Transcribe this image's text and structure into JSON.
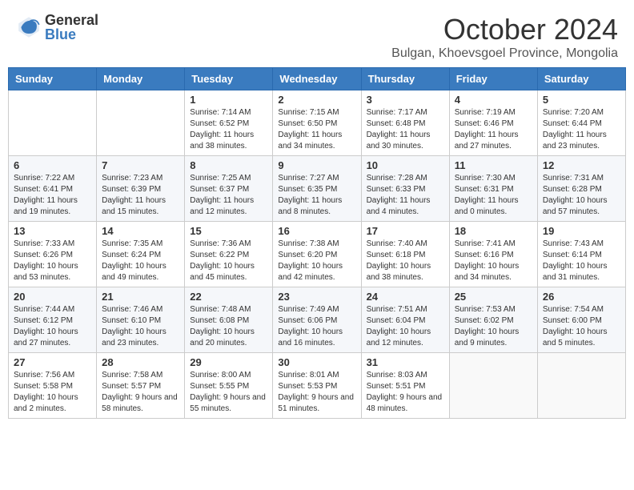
{
  "header": {
    "logo_general": "General",
    "logo_blue": "Blue",
    "month": "October 2024",
    "location": "Bulgan, Khoevsgoel Province, Mongolia"
  },
  "weekdays": [
    "Sunday",
    "Monday",
    "Tuesday",
    "Wednesday",
    "Thursday",
    "Friday",
    "Saturday"
  ],
  "weeks": [
    [
      {
        "day": "",
        "sunrise": "",
        "sunset": "",
        "daylight": ""
      },
      {
        "day": "",
        "sunrise": "",
        "sunset": "",
        "daylight": ""
      },
      {
        "day": "1",
        "sunrise": "Sunrise: 7:14 AM",
        "sunset": "Sunset: 6:52 PM",
        "daylight": "Daylight: 11 hours and 38 minutes."
      },
      {
        "day": "2",
        "sunrise": "Sunrise: 7:15 AM",
        "sunset": "Sunset: 6:50 PM",
        "daylight": "Daylight: 11 hours and 34 minutes."
      },
      {
        "day": "3",
        "sunrise": "Sunrise: 7:17 AM",
        "sunset": "Sunset: 6:48 PM",
        "daylight": "Daylight: 11 hours and 30 minutes."
      },
      {
        "day": "4",
        "sunrise": "Sunrise: 7:19 AM",
        "sunset": "Sunset: 6:46 PM",
        "daylight": "Daylight: 11 hours and 27 minutes."
      },
      {
        "day": "5",
        "sunrise": "Sunrise: 7:20 AM",
        "sunset": "Sunset: 6:44 PM",
        "daylight": "Daylight: 11 hours and 23 minutes."
      }
    ],
    [
      {
        "day": "6",
        "sunrise": "Sunrise: 7:22 AM",
        "sunset": "Sunset: 6:41 PM",
        "daylight": "Daylight: 11 hours and 19 minutes."
      },
      {
        "day": "7",
        "sunrise": "Sunrise: 7:23 AM",
        "sunset": "Sunset: 6:39 PM",
        "daylight": "Daylight: 11 hours and 15 minutes."
      },
      {
        "day": "8",
        "sunrise": "Sunrise: 7:25 AM",
        "sunset": "Sunset: 6:37 PM",
        "daylight": "Daylight: 11 hours and 12 minutes."
      },
      {
        "day": "9",
        "sunrise": "Sunrise: 7:27 AM",
        "sunset": "Sunset: 6:35 PM",
        "daylight": "Daylight: 11 hours and 8 minutes."
      },
      {
        "day": "10",
        "sunrise": "Sunrise: 7:28 AM",
        "sunset": "Sunset: 6:33 PM",
        "daylight": "Daylight: 11 hours and 4 minutes."
      },
      {
        "day": "11",
        "sunrise": "Sunrise: 7:30 AM",
        "sunset": "Sunset: 6:31 PM",
        "daylight": "Daylight: 11 hours and 0 minutes."
      },
      {
        "day": "12",
        "sunrise": "Sunrise: 7:31 AM",
        "sunset": "Sunset: 6:28 PM",
        "daylight": "Daylight: 10 hours and 57 minutes."
      }
    ],
    [
      {
        "day": "13",
        "sunrise": "Sunrise: 7:33 AM",
        "sunset": "Sunset: 6:26 PM",
        "daylight": "Daylight: 10 hours and 53 minutes."
      },
      {
        "day": "14",
        "sunrise": "Sunrise: 7:35 AM",
        "sunset": "Sunset: 6:24 PM",
        "daylight": "Daylight: 10 hours and 49 minutes."
      },
      {
        "day": "15",
        "sunrise": "Sunrise: 7:36 AM",
        "sunset": "Sunset: 6:22 PM",
        "daylight": "Daylight: 10 hours and 45 minutes."
      },
      {
        "day": "16",
        "sunrise": "Sunrise: 7:38 AM",
        "sunset": "Sunset: 6:20 PM",
        "daylight": "Daylight: 10 hours and 42 minutes."
      },
      {
        "day": "17",
        "sunrise": "Sunrise: 7:40 AM",
        "sunset": "Sunset: 6:18 PM",
        "daylight": "Daylight: 10 hours and 38 minutes."
      },
      {
        "day": "18",
        "sunrise": "Sunrise: 7:41 AM",
        "sunset": "Sunset: 6:16 PM",
        "daylight": "Daylight: 10 hours and 34 minutes."
      },
      {
        "day": "19",
        "sunrise": "Sunrise: 7:43 AM",
        "sunset": "Sunset: 6:14 PM",
        "daylight": "Daylight: 10 hours and 31 minutes."
      }
    ],
    [
      {
        "day": "20",
        "sunrise": "Sunrise: 7:44 AM",
        "sunset": "Sunset: 6:12 PM",
        "daylight": "Daylight: 10 hours and 27 minutes."
      },
      {
        "day": "21",
        "sunrise": "Sunrise: 7:46 AM",
        "sunset": "Sunset: 6:10 PM",
        "daylight": "Daylight: 10 hours and 23 minutes."
      },
      {
        "day": "22",
        "sunrise": "Sunrise: 7:48 AM",
        "sunset": "Sunset: 6:08 PM",
        "daylight": "Daylight: 10 hours and 20 minutes."
      },
      {
        "day": "23",
        "sunrise": "Sunrise: 7:49 AM",
        "sunset": "Sunset: 6:06 PM",
        "daylight": "Daylight: 10 hours and 16 minutes."
      },
      {
        "day": "24",
        "sunrise": "Sunrise: 7:51 AM",
        "sunset": "Sunset: 6:04 PM",
        "daylight": "Daylight: 10 hours and 12 minutes."
      },
      {
        "day": "25",
        "sunrise": "Sunrise: 7:53 AM",
        "sunset": "Sunset: 6:02 PM",
        "daylight": "Daylight: 10 hours and 9 minutes."
      },
      {
        "day": "26",
        "sunrise": "Sunrise: 7:54 AM",
        "sunset": "Sunset: 6:00 PM",
        "daylight": "Daylight: 10 hours and 5 minutes."
      }
    ],
    [
      {
        "day": "27",
        "sunrise": "Sunrise: 7:56 AM",
        "sunset": "Sunset: 5:58 PM",
        "daylight": "Daylight: 10 hours and 2 minutes."
      },
      {
        "day": "28",
        "sunrise": "Sunrise: 7:58 AM",
        "sunset": "Sunset: 5:57 PM",
        "daylight": "Daylight: 9 hours and 58 minutes."
      },
      {
        "day": "29",
        "sunrise": "Sunrise: 8:00 AM",
        "sunset": "Sunset: 5:55 PM",
        "daylight": "Daylight: 9 hours and 55 minutes."
      },
      {
        "day": "30",
        "sunrise": "Sunrise: 8:01 AM",
        "sunset": "Sunset: 5:53 PM",
        "daylight": "Daylight: 9 hours and 51 minutes."
      },
      {
        "day": "31",
        "sunrise": "Sunrise: 8:03 AM",
        "sunset": "Sunset: 5:51 PM",
        "daylight": "Daylight: 9 hours and 48 minutes."
      },
      {
        "day": "",
        "sunrise": "",
        "sunset": "",
        "daylight": ""
      },
      {
        "day": "",
        "sunrise": "",
        "sunset": "",
        "daylight": ""
      }
    ]
  ]
}
